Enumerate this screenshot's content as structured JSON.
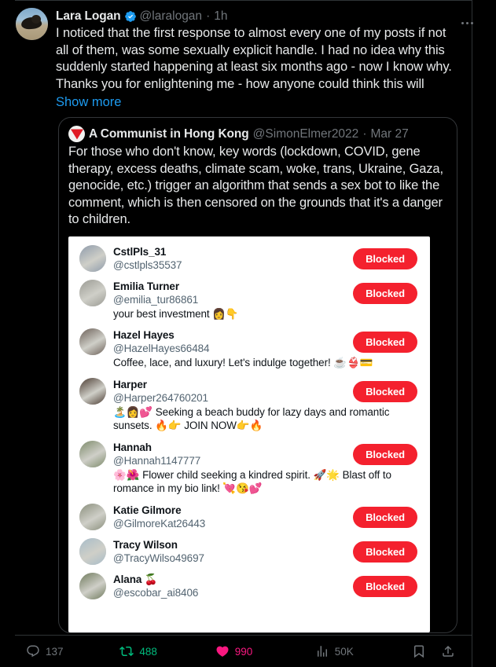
{
  "tweet": {
    "author_name": "Lara Logan",
    "author_handle": "@laralogan",
    "separator": "·",
    "timestamp": "1h",
    "verified_icon": "verified-badge-icon",
    "avatar_icon": "author-avatar",
    "more_icon": "more-options-icon",
    "text": "I noticed that the first response to almost every one of my posts if not all of them, was some sexually explicit handle. I had no idea why this suddenly started happening at least six months ago - now I know why. Thanks you for enlightening me - how anyone could think this will",
    "show_more_label": "Show more"
  },
  "quoted_tweet": {
    "author_name": "A Communist in Hong Kong",
    "author_handle": "@SimonElmer2022",
    "separator": "·",
    "date": "Mar 27",
    "avatar_icon": "red-triangle-avatar-icon",
    "text": "For those who don't know, key words (lockdown, COVID, gene therapy, excess deaths, climate scam, woke, trans, Ukraine, Gaza, genocide, etc.) trigger an algorithm that sends a sex bot to like the comment, which is then censored on the grounds that it's a danger to children.",
    "embedded_image": {
      "blocked_label": "Blocked",
      "accounts": [
        {
          "name": "CstlPls_31",
          "handle": "@cstlpls35537",
          "bio": "",
          "avatar_tone": "#8e9bab"
        },
        {
          "name": "Emilia Turner",
          "handle": "@emilia_tur86861",
          "bio": "your best investment 👩👇",
          "avatar_tone": "#9a9a93"
        },
        {
          "name": "Hazel Hayes",
          "handle": "@HazelHayes66484",
          "bio": "Coffee, lace, and luxury! Let's indulge together! ☕👙💳",
          "avatar_tone": "#6b5f57"
        },
        {
          "name": "Harper",
          "handle": "@Harper264760201",
          "bio": "🏝️👩💕 Seeking a beach buddy for lazy days and romantic sunsets. 🔥👉 JOIN NOW👉🔥",
          "avatar_tone": "#4a3a30"
        },
        {
          "name": "Hannah",
          "handle": "@Hannah1147777",
          "bio": "🌸🌺 Flower child seeking a kindred spirit. 🚀🌟 Blast off to romance in my bio link! 💘😘💕",
          "avatar_tone": "#7d8b6a"
        },
        {
          "name": "Katie Gilmore",
          "handle": "@GilmoreKat26443",
          "bio": "",
          "avatar_tone": "#8a8f7c"
        },
        {
          "name": "Tracy Wilson",
          "handle": "@TracyWilso49697",
          "bio": "",
          "avatar_tone": "#a7bcc9"
        },
        {
          "name": "Alana 🍒",
          "handle": "@escobar_ai8406",
          "bio": "",
          "avatar_tone": "#6f7a5c"
        }
      ]
    }
  },
  "actions": {
    "reply_count": "137",
    "retweet_count": "488",
    "like_count": "990",
    "view_count": "50K",
    "bookmark_icon": "bookmark-icon",
    "share_icon": "share-icon"
  },
  "colors": {
    "background": "#000000",
    "text_primary": "#e7e9ea",
    "text_secondary": "#71767b",
    "link": "#1d9bf0",
    "verified": "#1d9bf0",
    "retweet_green": "#00ba7c",
    "like_pink": "#f91880",
    "blocked_red": "#f4212e",
    "border": "#2f3336"
  }
}
